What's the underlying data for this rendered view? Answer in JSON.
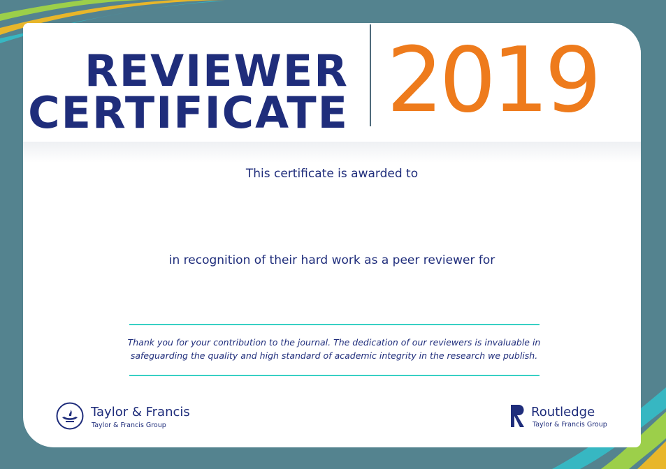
{
  "certificate": {
    "title_line1": "REVIEWER",
    "title_line2": "CERTIFICATE",
    "year": "2019",
    "awarded_text": "This certificate is awarded to",
    "recognition_text": "in recognition of their hard work as a peer reviewer for",
    "thanks_text": "Thank you for your contribution to the journal. The dedication of our reviewers is invaluable in safeguarding the quality and high standard of academic integrity in the research we publish."
  },
  "logos": {
    "left": {
      "name": "Taylor & Francis",
      "group": "Taylor & Francis Group",
      "icon": "taylor-francis-lamp-icon"
    },
    "right": {
      "name": "Routledge",
      "group": "Taylor & Francis Group",
      "icon": "routledge-r-icon"
    }
  },
  "colors": {
    "navy": "#1f2d7b",
    "orange": "#ee7b1c",
    "teal_border": "#54838f",
    "accent_rule": "#38d0c4"
  }
}
